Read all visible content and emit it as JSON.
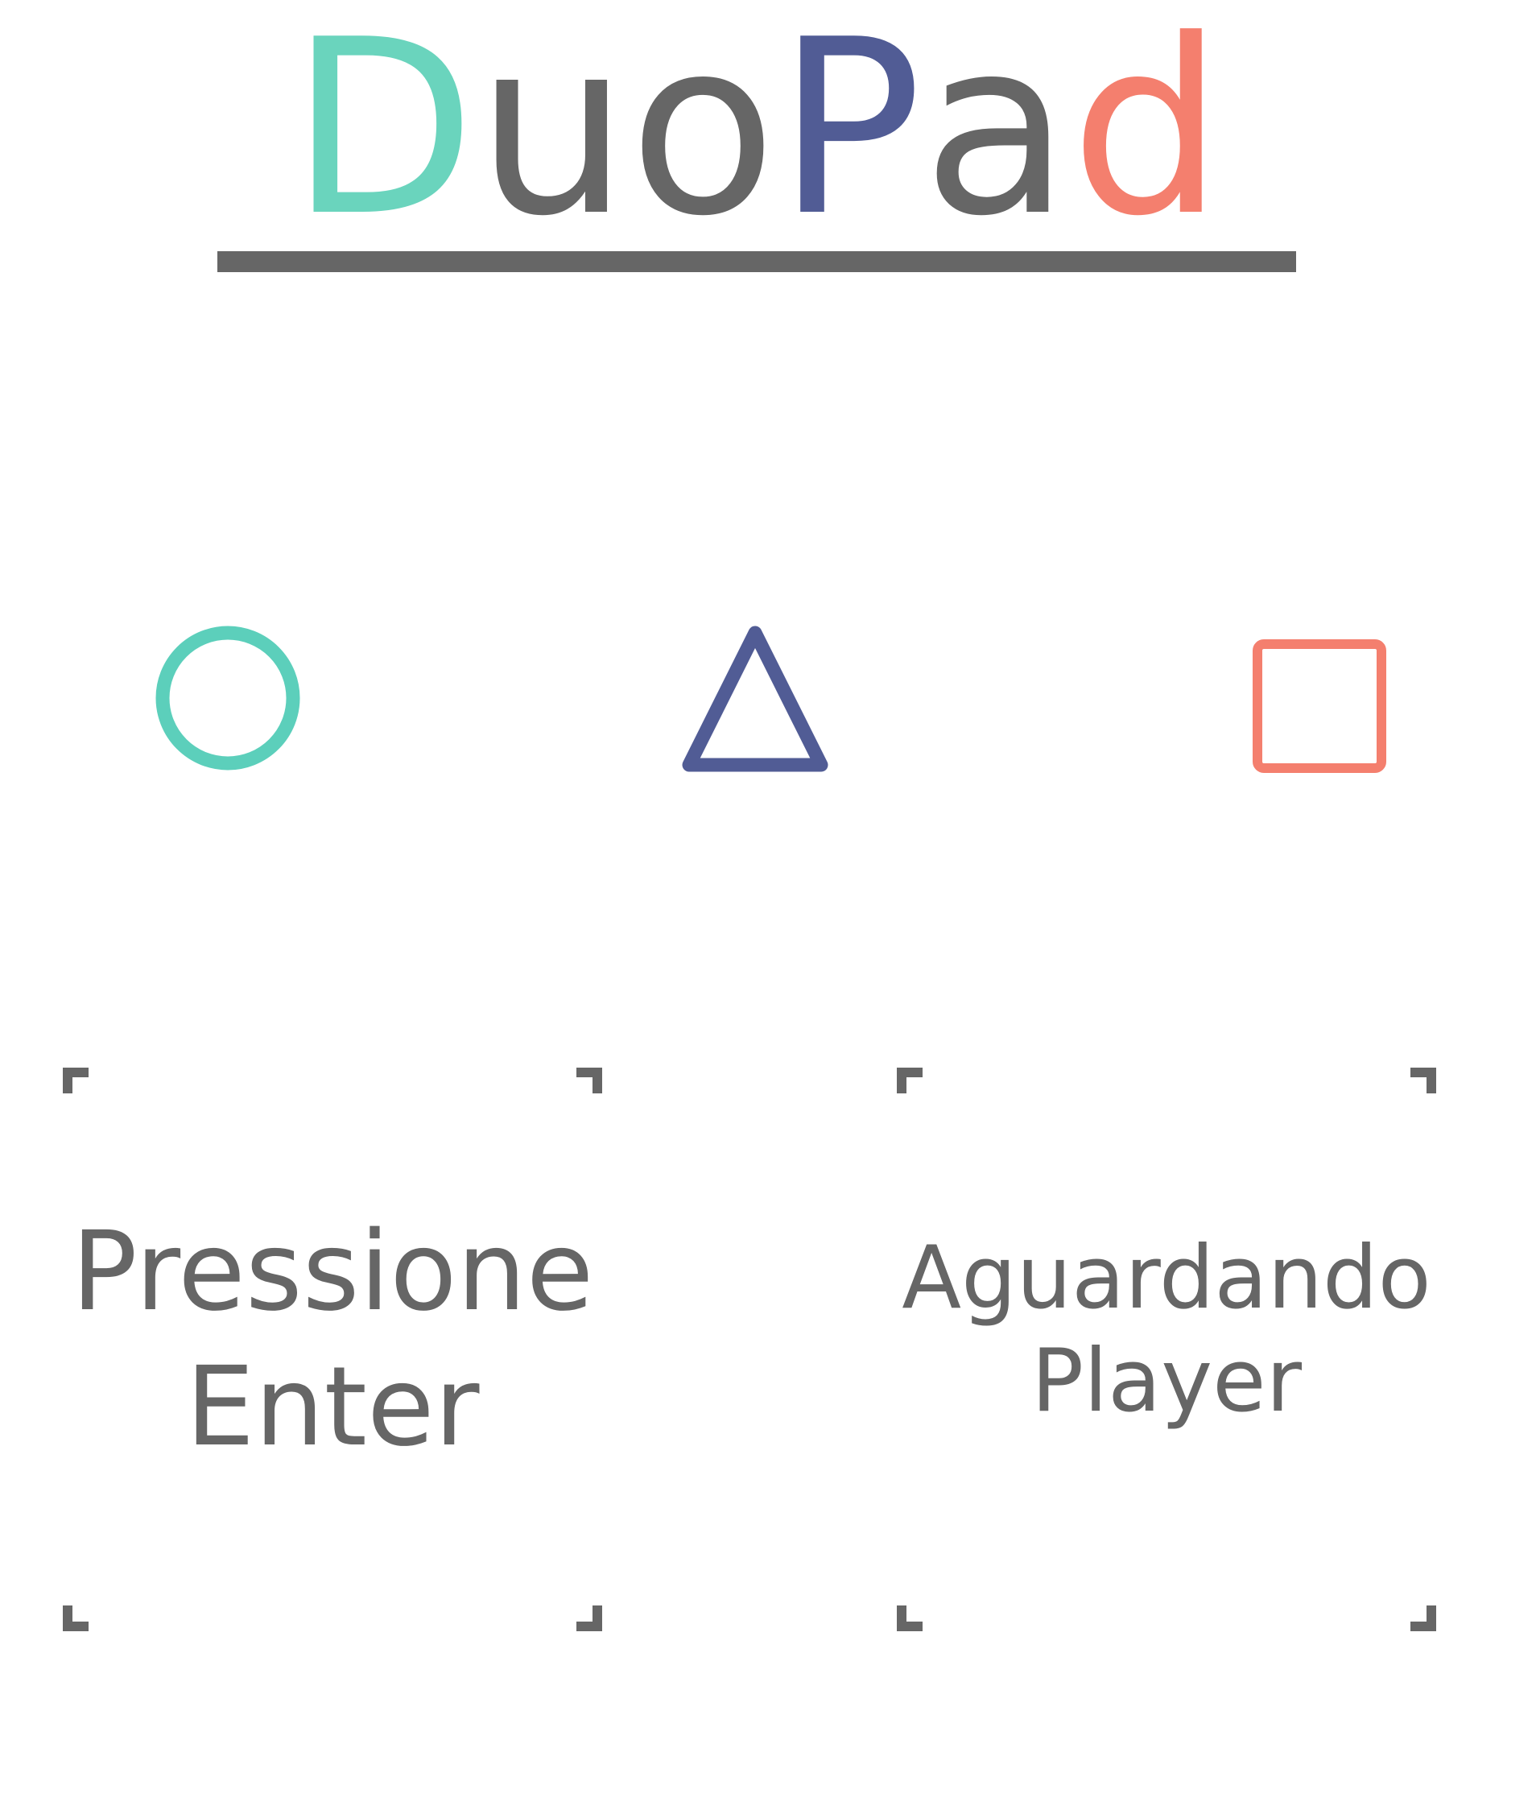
{
  "logo": {
    "letters": [
      {
        "char": "D",
        "color": "#6ad4bd"
      },
      {
        "char": "u",
        "color": "#666666"
      },
      {
        "char": "o",
        "color": "#666666"
      },
      {
        "char": "P",
        "color": "#515c95"
      },
      {
        "char": "a",
        "color": "#666666"
      },
      {
        "char": "d",
        "color": "#f47f6e"
      }
    ],
    "underline_color": "#666666"
  },
  "buttons": {
    "circle": {
      "icon": "circle-icon",
      "color": "#5ccfbb"
    },
    "triangle": {
      "icon": "triangle-icon",
      "color": "#515c95"
    },
    "square": {
      "icon": "square-icon",
      "color": "#f47f6e"
    }
  },
  "players": [
    {
      "line1": "Pressione",
      "line2": "Enter"
    },
    {
      "line1": "Aguardando",
      "line2": "Player"
    }
  ],
  "colors": {
    "text": "#666666",
    "background": "#ffffff"
  }
}
